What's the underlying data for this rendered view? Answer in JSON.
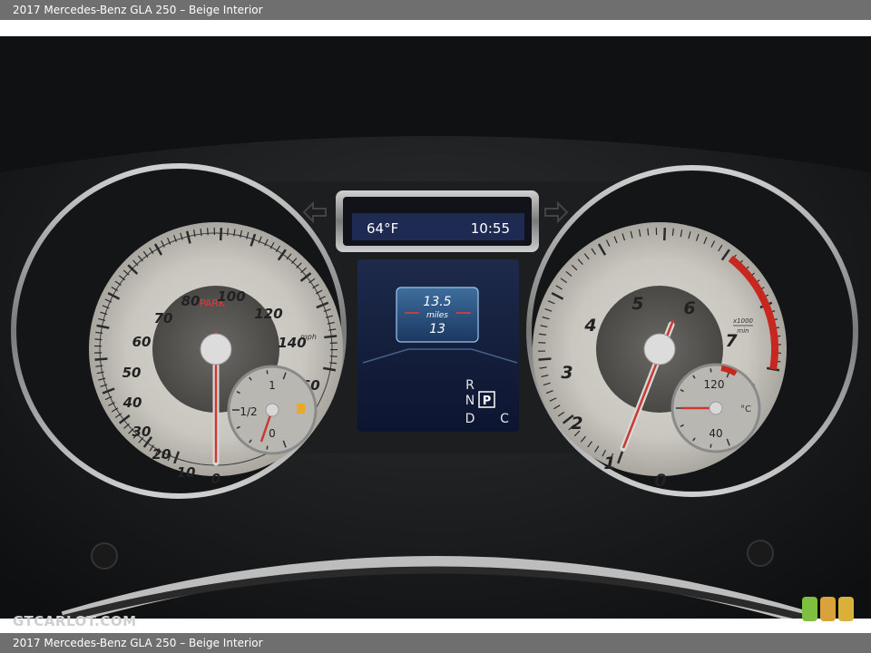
{
  "header": {
    "title": "2017 Mercedes-Benz GLA 250 – Beige Interior"
  },
  "footer": {
    "caption": "2017 Mercedes-Benz GLA 250 – Beige Interior"
  },
  "watermark": {
    "text": "GTCARLOT.COM"
  },
  "swatches": {
    "colors": [
      "#7fbf3f",
      "#d9a23a",
      "#d9b13a"
    ]
  },
  "cluster": {
    "top_display": {
      "temperature": "64°F",
      "time": "10:55"
    },
    "trip_display": {
      "top_value": "13.5",
      "unit": "miles",
      "bottom_value": "13"
    },
    "gear_indicator": {
      "r": "R",
      "n": "N",
      "p": "P",
      "d": "D",
      "mode": "C"
    },
    "speedometer": {
      "status_label": "PARK",
      "unit": "mph",
      "labels": [
        "0",
        "10",
        "20",
        "30",
        "40",
        "50",
        "60",
        "70",
        "80",
        "100",
        "120",
        "140",
        "160"
      ],
      "fuel_gauge": {
        "labels": [
          "1",
          "1/2",
          "0"
        ]
      }
    },
    "tachometer": {
      "labels": [
        "0",
        "1",
        "2",
        "3",
        "4",
        "5",
        "6",
        "7",
        "8"
      ],
      "unit_top": "x1000",
      "unit_bottom": "min",
      "coolant_gauge": {
        "labels": [
          "120",
          "40"
        ],
        "unit": "°C"
      }
    }
  }
}
